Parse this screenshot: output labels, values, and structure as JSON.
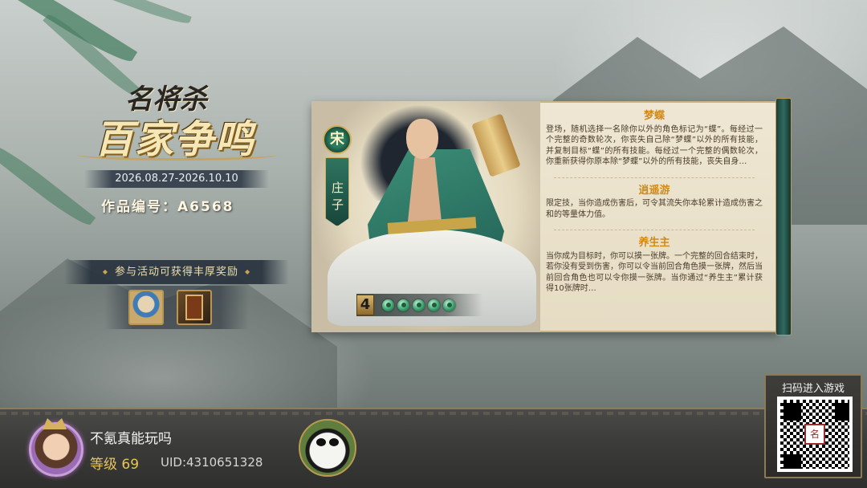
{
  "event": {
    "logo_line1": "名将杀",
    "logo_line2": "百家争鸣",
    "date_range": "2026.08.27-2026.10.10",
    "work_number": "作品编号：A6568",
    "reward_caption": "参与活动可获得丰厚奖励",
    "rewards": [
      "avatar-reward-icon",
      "scroll-book-reward-icon"
    ]
  },
  "hero": {
    "faction": "宋",
    "name": "庄子",
    "hp_number": "4",
    "hp_pips": 5,
    "colors": {
      "robe": "#3d8f78",
      "accent": "#cfae5d"
    },
    "skills": [
      {
        "title": "梦蝶",
        "desc": "登场，随机选择一名除你以外的角色标记为“蝶”。每经过一个完整的奇数轮次，你丧失自己除“梦蝶”以外的所有技能，并复制目标“蝶”的所有技能。每经过一个完整的偶数轮次，你重新获得你原本除“梦蝶”以外的所有技能，丧失自身…"
      },
      {
        "title": "逍遥游",
        "desc": "限定技，当你造成伤害后，可令其流失你本轮累计造成伤害之和的等量体力值。"
      },
      {
        "title": "养生主",
        "desc": "当你成为目标时，你可以摸一张牌。一个完整的回合结束时，若你没有受到伤害，你可以令当前回合角色摸一张牌，然后当前回合角色也可以令你摸一张牌。当你通过“养生主”累计获得10张牌时…"
      }
    ]
  },
  "player": {
    "name": "不氪真能玩吗",
    "level": "等级 69",
    "uid": "UID:4310651328",
    "avatar_icon": "player-avatar",
    "badge_icon": "panda-badge-icon"
  },
  "qr": {
    "label": "扫码进入游戏",
    "center_mark": "名"
  }
}
